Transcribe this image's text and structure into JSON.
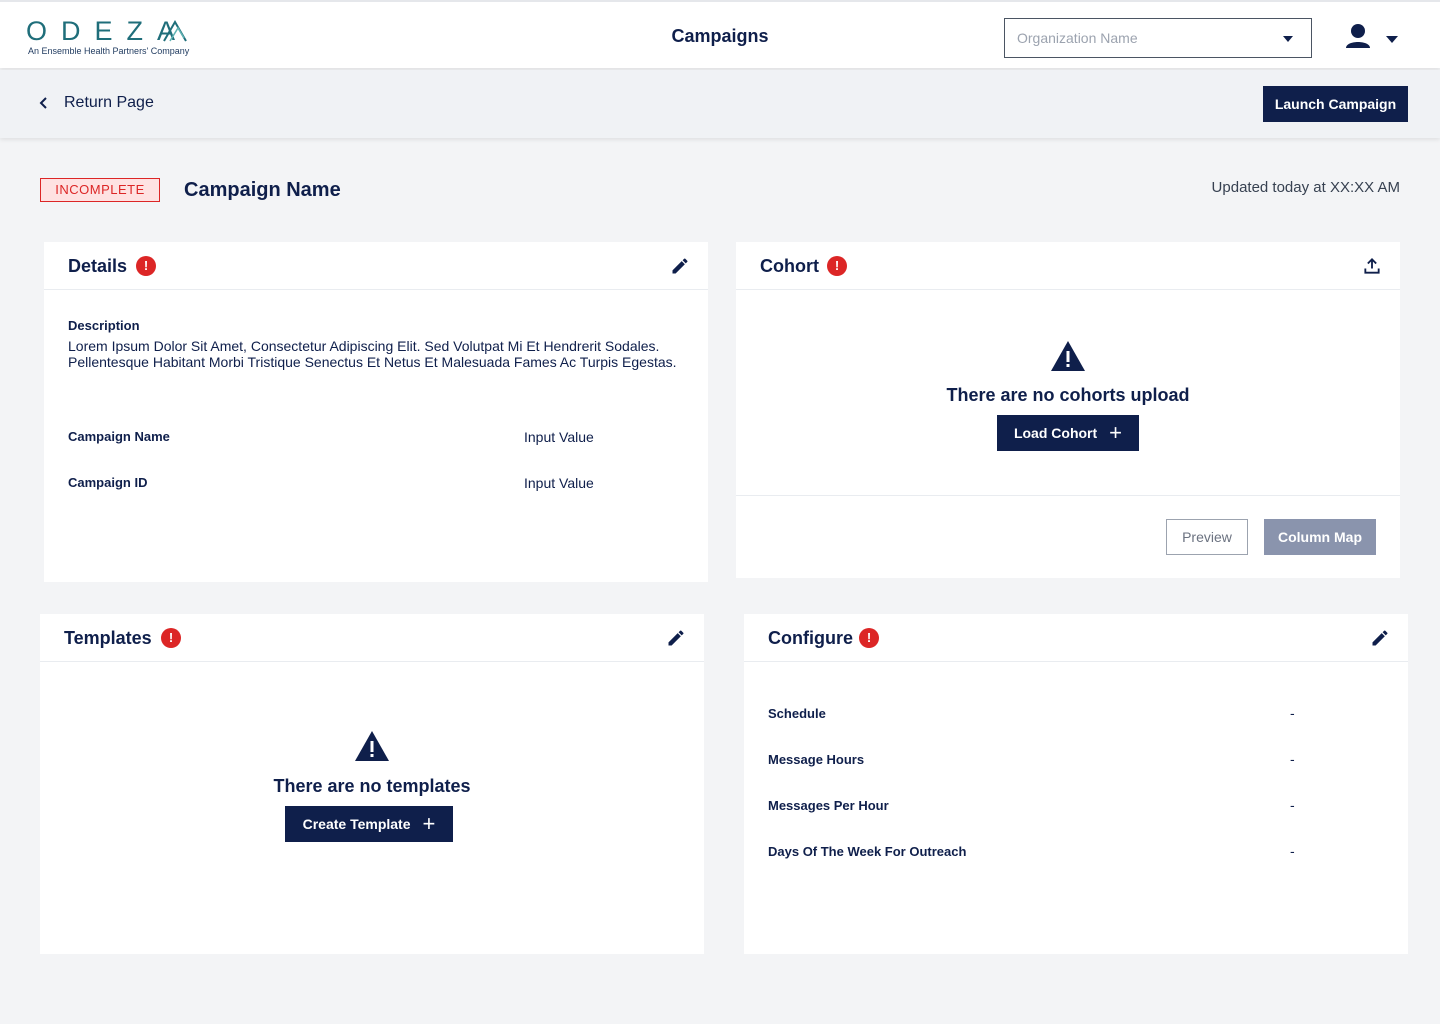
{
  "header": {
    "logo_word": "ODEZA",
    "logo_sub": "An Ensemble Health Partners' Company",
    "title": "Campaigns",
    "org_select_placeholder": "Organization Name"
  },
  "subheader": {
    "return_label": "Return Page",
    "launch_label": "Launch Campaign"
  },
  "campaign": {
    "status": "INCOMPLETE",
    "name": "Campaign Name",
    "updated": "Updated today at XX:XX AM"
  },
  "details": {
    "title": "Details",
    "alert": "!",
    "description_label": "Description",
    "description_text": "Lorem Ipsum Dolor Sit Amet, Consectetur Adipiscing Elit. Sed Volutpat Mi Et Hendrerit Sodales. Pellentesque Habitant Morbi Tristique Senectus Et Netus Et Malesuada Fames Ac Turpis Egestas.",
    "fields": [
      {
        "label": "Campaign Name",
        "value": "Input Value"
      },
      {
        "label": "Campaign ID",
        "value": "Input Value"
      }
    ]
  },
  "cohort": {
    "title": "Cohort",
    "alert": "!",
    "empty_text": "There are no cohorts upload",
    "load_label": "Load Cohort",
    "preview_label": "Preview",
    "column_map_label": "Column Map"
  },
  "templates": {
    "title": "Templates",
    "alert": "!",
    "empty_text": "There are no templates",
    "create_label": "Create Template"
  },
  "configure": {
    "title": "Configure",
    "alert": "!",
    "fields": [
      {
        "label": "Schedule",
        "value": "-"
      },
      {
        "label": "Message Hours",
        "value": "-"
      },
      {
        "label": "Messages Per Hour",
        "value": "-"
      },
      {
        "label": "Days Of The Week For Outreach",
        "value": "-"
      }
    ]
  },
  "icons": {
    "user": "user-icon",
    "edit": "pencil-icon",
    "upload": "upload-icon",
    "warning": "warning-triangle-icon",
    "back": "chevron-left-icon"
  },
  "colors": {
    "navy": "#0f1f4b",
    "alert_red": "#dc2626",
    "logo_teal": "#1f6e7a"
  }
}
